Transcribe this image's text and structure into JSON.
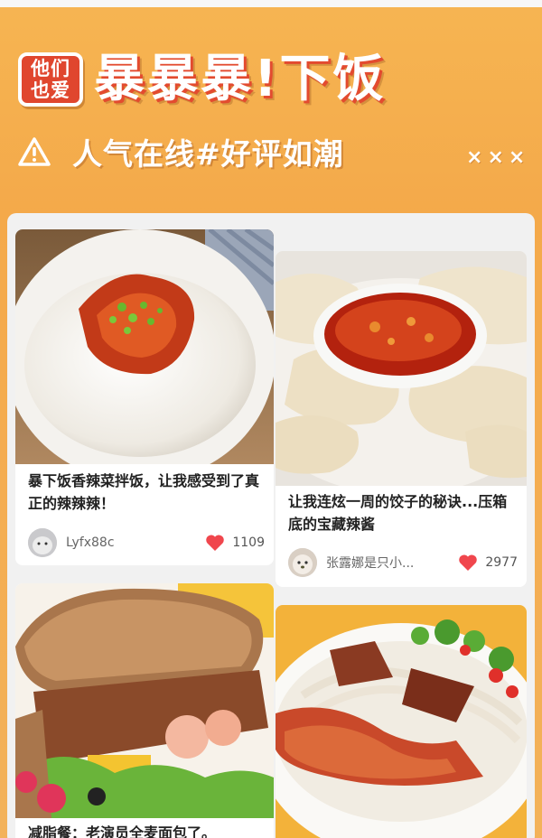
{
  "banner": {
    "badge_line1": "他们",
    "badge_line2": "也爱",
    "title": "暴暴暴!下饭",
    "subtitle": "人气在线#好评如潮",
    "decor": [
      "×",
      "×",
      "×"
    ]
  },
  "posts": [
    {
      "caption": "暴下饭香辣菜拌饭，让我感受到了真正的辣辣辣！",
      "username": "Lyfx88c",
      "likes": "1109",
      "image": "rice-bowl-with-chili-sauce"
    },
    {
      "caption": "让我连炫一周的饺子的秘诀...压箱底的宝藏辣酱",
      "username": "张露娜是只小...",
      "likes": "2977",
      "image": "dumplings-with-chili-oil"
    },
    {
      "caption": "减脂餐：老演员全麦面包了。",
      "image": "whole-wheat-sandwich"
    },
    {
      "image": "beef-rice-noodle-bowl"
    }
  ],
  "colors": {
    "accent": "#e0462e",
    "heart": "#f0464d",
    "background": "#f4a94a"
  }
}
